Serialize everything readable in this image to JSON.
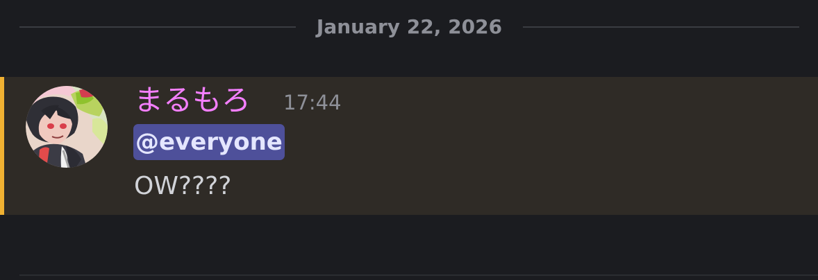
{
  "divider": {
    "date": "January 22, 2026"
  },
  "message": {
    "username": "まるもろ",
    "timestamp": "17:44",
    "mention": "@everyone",
    "text": "OW????",
    "avatar": "avatar-image",
    "colors": {
      "username": "#f47fff",
      "mention_bg": "#4e509a",
      "highlight_bar": "#f0b132",
      "highlight_bg": "#2f2b26"
    }
  }
}
